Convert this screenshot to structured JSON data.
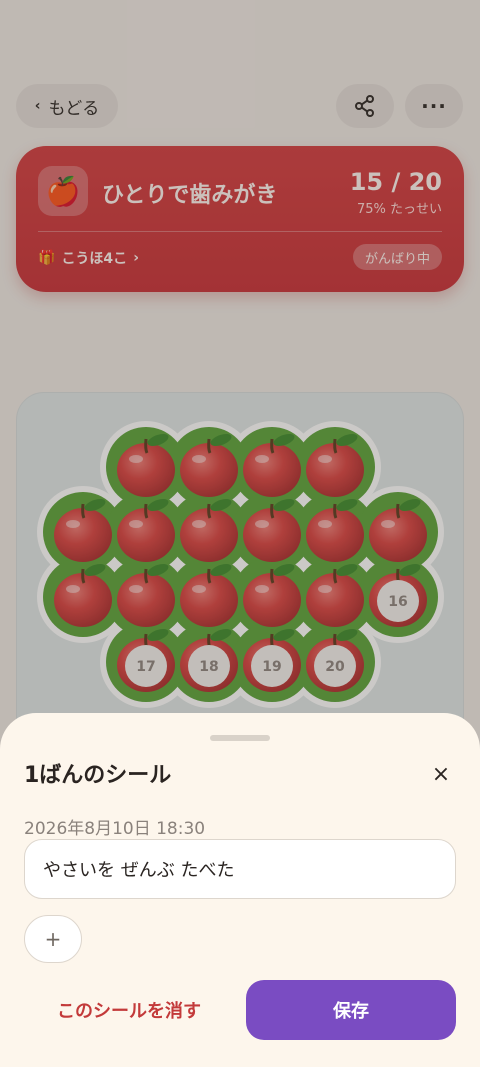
{
  "topbar": {
    "back_label": "もどる",
    "share_icon": "share-icon",
    "more_label": "···"
  },
  "goal": {
    "icon": "🍎",
    "title": "ひとりで歯みがき",
    "count": "15 / 20",
    "percent": "75% たっせい",
    "gift_icon": "🎁",
    "gift_label": "こうほ4こ",
    "gift_chevron": "›",
    "status": "がんばり中",
    "progress_fraction": 0.75
  },
  "board": {
    "filled_count": 15,
    "empty_labels": [
      "16",
      "17",
      "18",
      "19",
      "20"
    ]
  },
  "sheet": {
    "title": "1ばんのシール",
    "close_label": "×",
    "date": "2026年8月10日 18:30",
    "memo": "やさいを ぜんぶ たべた",
    "add_label": "+",
    "delete_label": "このシールを消す",
    "save_label": "保存"
  },
  "colors": {
    "card_red": "#cc3339",
    "save_purple": "#7a4cc2",
    "delete_red": "#c33a3a",
    "leaf_green": "#5aa238"
  }
}
